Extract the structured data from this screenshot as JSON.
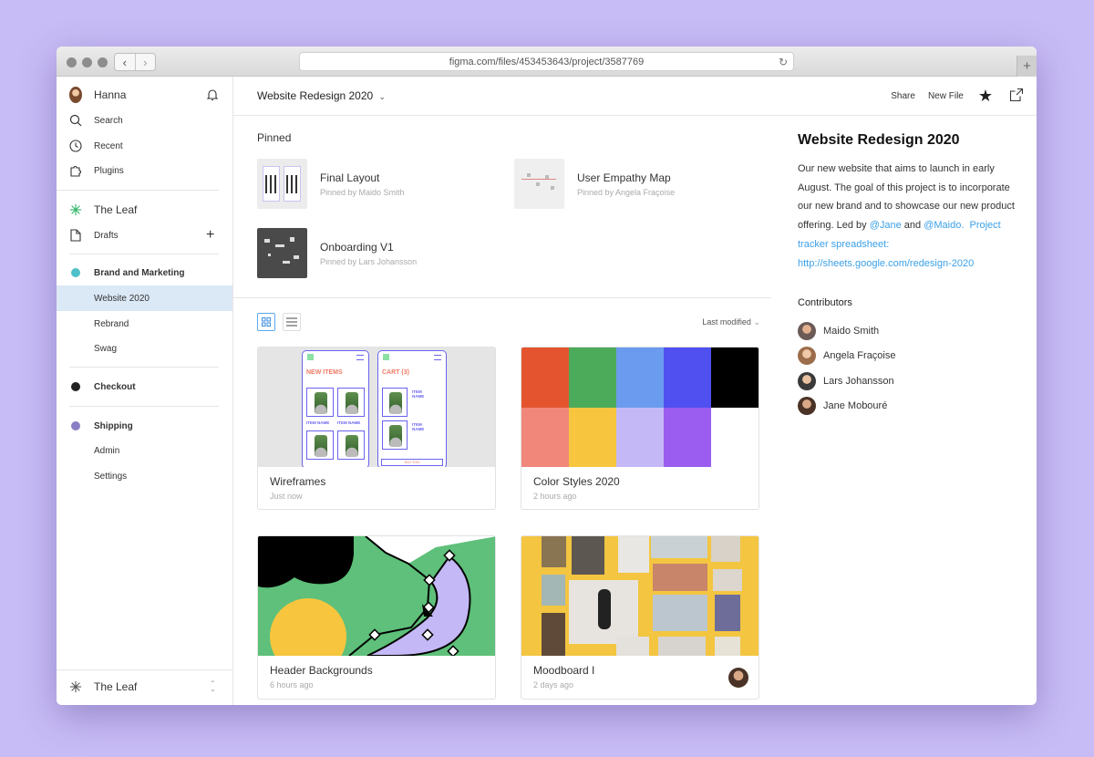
{
  "browser": {
    "url": "figma.com/files/453453643/project/3587769",
    "back_icon": "chevron-left-icon",
    "forward_icon": "chevron-right-icon",
    "reload_icon": "reload-icon"
  },
  "sidebar": {
    "user_name": "Hanna",
    "search": "Search",
    "recent": "Recent",
    "plugins": "Plugins",
    "team_name": "The Leaf",
    "drafts": "Drafts",
    "groups": [
      {
        "name": "Brand and Marketing",
        "color": "#4ec0c9",
        "items": [
          "Website 2020",
          "Rebrand",
          "Swag"
        ]
      },
      {
        "name": "Checkout",
        "color": "#222222",
        "items": []
      },
      {
        "name": "Shipping",
        "color": "#8a7fc4",
        "items": [
          "Admin",
          "Settings"
        ]
      }
    ],
    "footer_team": "The Leaf"
  },
  "topbar": {
    "project_title": "Website Redesign 2020",
    "share": "Share",
    "new_file": "New File"
  },
  "pinned": {
    "title": "Pinned",
    "items": [
      {
        "name": "Final Layout",
        "by": "Pinned by Maido Smith"
      },
      {
        "name": "User Empathy Map",
        "by": "Pinned by Angela Fraçoise"
      },
      {
        "name": "Onboarding V1",
        "by": "Pinned by Lars Johansson"
      }
    ]
  },
  "files": {
    "sort_label": "Last modified",
    "cards": [
      {
        "title": "Wireframes",
        "time": "Just now"
      },
      {
        "title": "Color Styles 2020",
        "time": "2 hours ago"
      },
      {
        "title": "Header Backgrounds",
        "time": "6 hours ago"
      },
      {
        "title": "Moodboard I",
        "time": "2 days ago"
      }
    ],
    "wireframe": {
      "new_items": "NEW ITEMS",
      "cart": "CART (3)",
      "item_name": "ITEM NAME",
      "button": "BUTTON"
    },
    "swatches": [
      "#e4552f",
      "#4bab5b",
      "#6b9bef",
      "#5050f0",
      "#000000",
      "#f0877a",
      "#f8c53e",
      "#c4b8f6",
      "#9b5cf0",
      "#ffffff"
    ]
  },
  "details": {
    "title": "Website Redesign 2020",
    "desc_1": "Our new website that aims to launch in early August. The goal of this project is to incorporate our new brand and to showcase our new product offering. Led by ",
    "mention_1": "@Jane",
    "desc_2": " and ",
    "mention_2": "@Maido.",
    "link_1": "Project tracker spreadsheet:",
    "link_2": "http://sheets.google.com/redesign-2020",
    "contributors_title": "Contributors",
    "contributors": [
      "Maido Smith",
      "Angela Fraçoise",
      "Lars Johansson",
      "Jane Mobouré"
    ]
  }
}
